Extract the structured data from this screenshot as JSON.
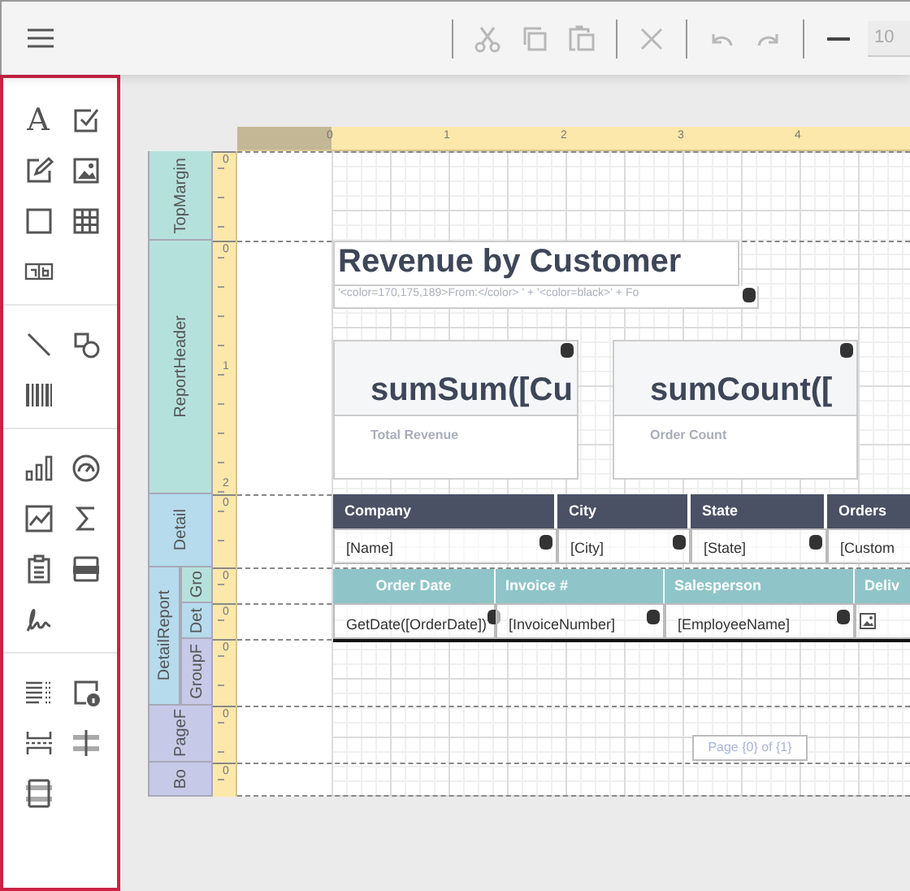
{
  "toolbar": {
    "items": [
      {
        "kind": "cut",
        "disabled": true
      },
      {
        "kind": "copy",
        "disabled": true
      },
      {
        "kind": "paste",
        "disabled": true
      },
      {
        "kind": "delete",
        "disabled": true
      },
      {
        "kind": "undo",
        "disabled": true
      },
      {
        "kind": "redo",
        "disabled": true
      },
      {
        "kind": "zoom-out",
        "disabled": false
      }
    ],
    "zoom": "10"
  },
  "toolbox": {
    "groups": [
      [
        {
          "kind": "label",
          "glyph": "A"
        },
        {
          "kind": "checkbox"
        },
        {
          "kind": "richtext"
        },
        {
          "kind": "picture"
        },
        {
          "kind": "panel"
        },
        {
          "kind": "table"
        },
        {
          "kind": "charcomb"
        }
      ],
      [
        {
          "kind": "line"
        },
        {
          "kind": "shape"
        },
        {
          "kind": "barcode"
        }
      ],
      [
        {
          "kind": "chart"
        },
        {
          "kind": "gauge"
        },
        {
          "kind": "sparkline"
        },
        {
          "kind": "sum"
        },
        {
          "kind": "subreport"
        },
        {
          "kind": "pdf"
        },
        {
          "kind": "signature"
        }
      ],
      [
        {
          "kind": "toc"
        },
        {
          "kind": "pageinfo"
        },
        {
          "kind": "pagebreak"
        },
        {
          "kind": "crossline"
        },
        {
          "kind": "crossbox"
        }
      ]
    ]
  },
  "ruler": {
    "marks": [
      "0",
      "1",
      "2",
      "3",
      "4"
    ]
  },
  "bands": [
    {
      "name": "TopMargin",
      "color": "#b5e1dc",
      "ruler": [
        "0"
      ]
    },
    {
      "name": "ReportHeader",
      "color": "#b5e1dc",
      "ruler": [
        "0",
        "1",
        "2"
      ]
    },
    {
      "name": "Detail",
      "color": "#b5dbed",
      "ruler": [
        "0"
      ]
    },
    {
      "name": "DetailReport",
      "color": "#b5dbed",
      "children": [
        {
          "name": "Gro",
          "color": "#b5e1dc",
          "ruler": [
            "0"
          ]
        },
        {
          "name": "Det",
          "color": "#b5dbed",
          "ruler": [
            "0"
          ]
        },
        {
          "name": "GroupF",
          "color": "#c6cae8",
          "ruler": [
            "0"
          ]
        }
      ]
    },
    {
      "name": "PageF",
      "color": "#c6cae8",
      "ruler": [
        "0"
      ]
    },
    {
      "name": "Bo",
      "color": "#c6cae8",
      "ruler": [
        "0"
      ]
    }
  ],
  "report": {
    "title": "Revenue by Customer",
    "subtitle": "'<color=170,175,189>From:</color> ' + '<color=black>' + Fo",
    "summaries": [
      {
        "value": "sumSum([Cu",
        "label": "Total Revenue"
      },
      {
        "value": "sumCount([",
        "label": "Order Count"
      }
    ],
    "table_header": [
      "Company",
      "City",
      "State",
      "Orders"
    ],
    "table_row": [
      "[Name]",
      "[City]",
      "[State]",
      "[Custom"
    ],
    "group_header": [
      "Order Date",
      "Invoice #",
      "Salesperson",
      "Deliv"
    ],
    "detail_row": [
      {
        "kind": "field",
        "text": "GetDate([OrderDate])"
      },
      {
        "kind": "field",
        "text": "[InvoiceNumber]"
      },
      {
        "kind": "field",
        "text": "[EmployeeName]"
      },
      {
        "kind": "picture"
      }
    ],
    "page_info": "Page {0} of {1}"
  }
}
